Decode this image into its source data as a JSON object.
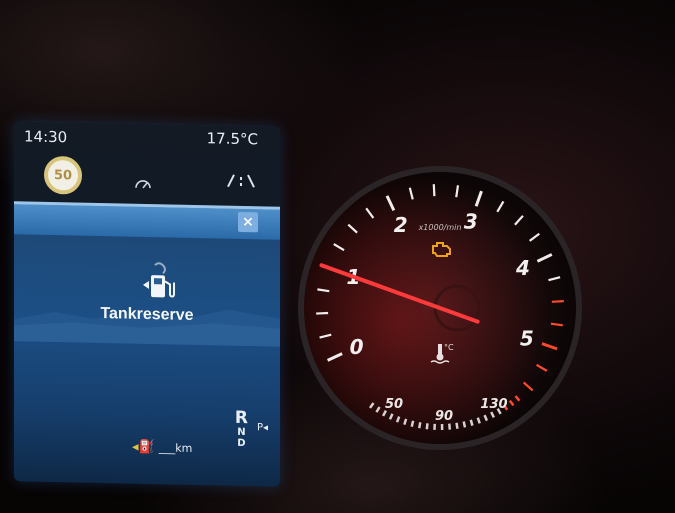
{
  "display": {
    "time": "14:30",
    "temperature": "17.5°C",
    "speed_limit": "50",
    "message": "Tankreserve",
    "close_symbol": "×",
    "range_value": "___km",
    "gears": [
      "R",
      "N",
      "D"
    ],
    "gear_p": "P◂"
  },
  "tachometer": {
    "unit_label": "x1000/min",
    "rpm_labels": [
      "0",
      "1",
      "2",
      "3",
      "4",
      "5"
    ],
    "needle_value": 1.0,
    "warning": "check-engine-icon"
  },
  "coolant": {
    "labels": [
      "50",
      "90",
      "130"
    ]
  },
  "colors": {
    "display_blue": "#1c4f86",
    "needle_red": "#ff3a3a",
    "warning_amber": "#f0a21a",
    "redline": "#ff4a2a"
  }
}
